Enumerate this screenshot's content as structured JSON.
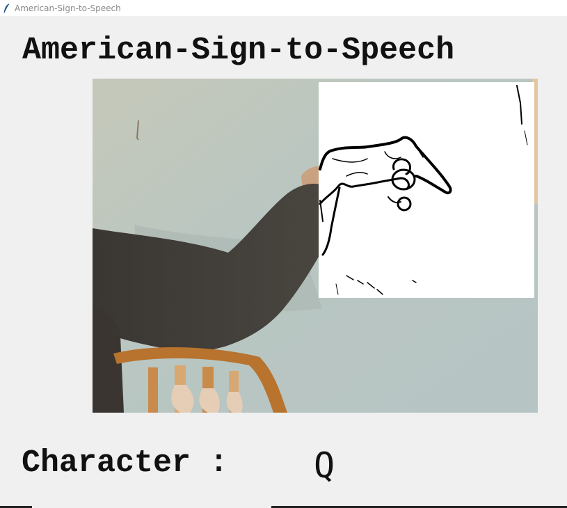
{
  "window": {
    "title": "American-Sign-to-Speech",
    "icon": "feather-icon"
  },
  "app": {
    "heading": "American-Sign-to-Speech"
  },
  "prediction": {
    "label": "Character :",
    "value": "Q"
  },
  "colors": {
    "background": "#f0f0f0",
    "text": "#111111",
    "titlebar_text": "#8a8a8a",
    "roi_background": "#ffffff"
  }
}
